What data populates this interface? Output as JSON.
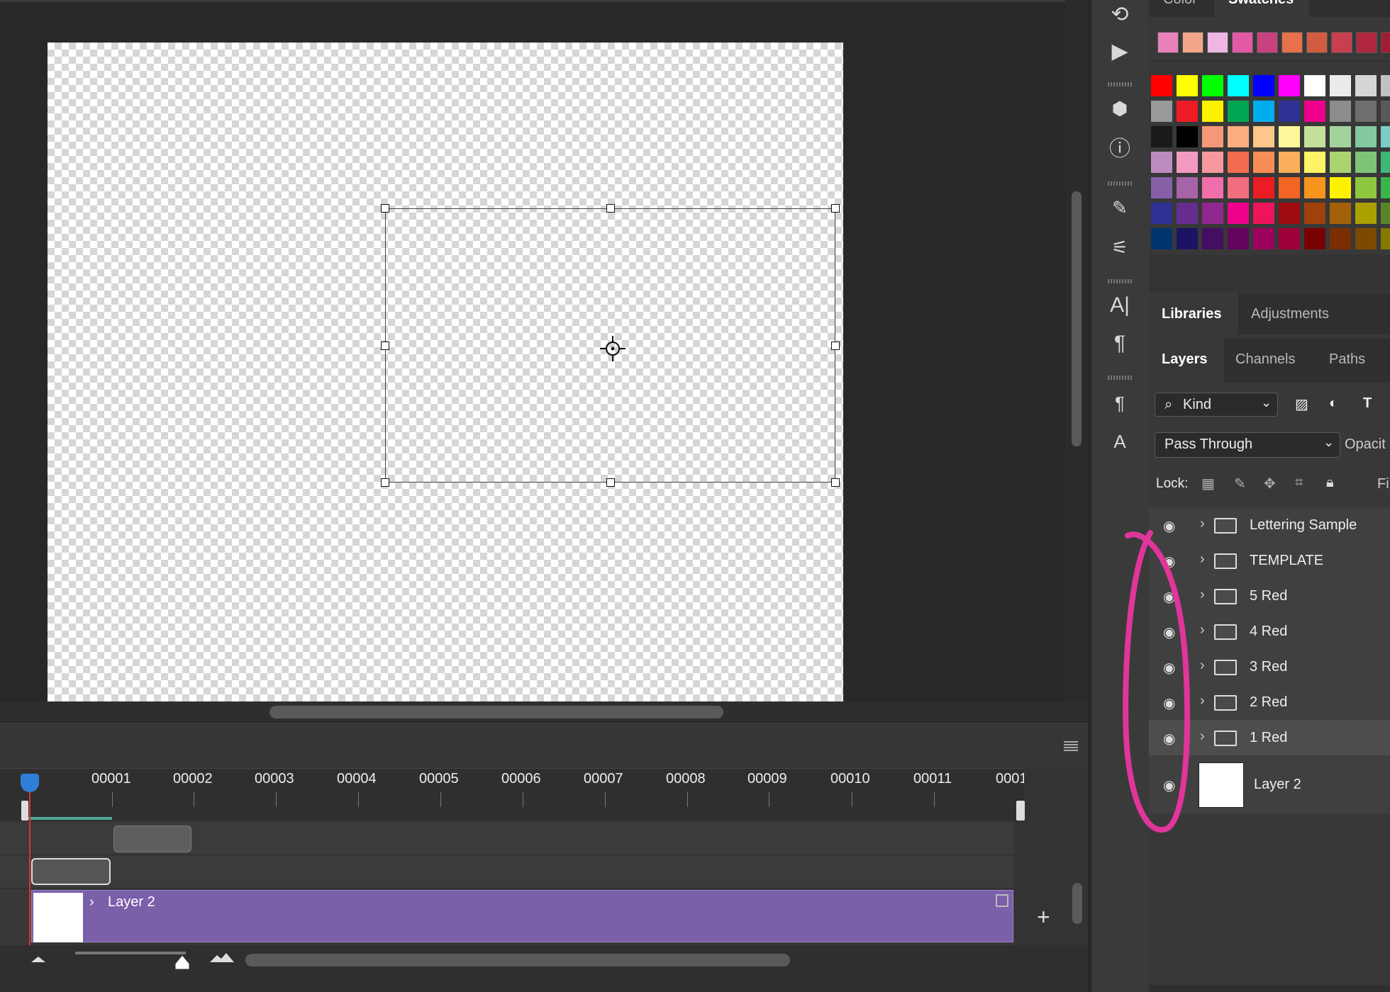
{
  "swatches_panel": {
    "tab_color": "Color",
    "tab_swatches": "Swatches",
    "recent": [
      "#e882b8",
      "#f4a68a",
      "#eeb6e2",
      "#e25aa6",
      "#c94280",
      "#e7704d",
      "#d25c42",
      "#c8404f",
      "#b0283e",
      "#a01e34",
      "#c23c5c"
    ],
    "grid": [
      [
        "#ff0000",
        "#ffff00",
        "#00ff00",
        "#00ffff",
        "#0000ff",
        "#ff00ff",
        "#ffffff",
        "#ebebeb",
        "#d6d6d6",
        "#c2c2c2"
      ],
      [
        "#999999",
        "#ed1c24",
        "#fff200",
        "#00a651",
        "#00aeef",
        "#2e3192",
        "#ec008c",
        "#8c8c8c",
        "#6e6e6e",
        "#5a5a5a"
      ],
      [
        "#1a1a1a",
        "#000000",
        "#f7977a",
        "#f9ad81",
        "#fdc68a",
        "#fff79a",
        "#c4df9b",
        "#a3d39c",
        "#82ca9d",
        "#7bcdc8"
      ],
      [
        "#bd8cbf",
        "#f49ac2",
        "#f6989d",
        "#f26c4f",
        "#f68e55",
        "#fbaf5c",
        "#fff467",
        "#acd372",
        "#7cc576",
        "#3bb878"
      ],
      [
        "#8560a8",
        "#a763a8",
        "#f06ea9",
        "#f26d7d",
        "#ed1c24",
        "#f26522",
        "#f7941d",
        "#fff200",
        "#8dc73f",
        "#39b54a"
      ],
      [
        "#2e3192",
        "#662d91",
        "#92278f",
        "#ec008c",
        "#ed145b",
        "#9e0b0f",
        "#a0410d",
        "#a36209",
        "#aba000",
        "#598527"
      ],
      [
        "#003471",
        "#1b1464",
        "#440e62",
        "#630460",
        "#9e005d",
        "#9e0039",
        "#790000",
        "#7b2e00",
        "#7d4900",
        "#827b00"
      ]
    ]
  },
  "panels": {
    "libraries": "Libraries",
    "adjustments": "Adjustments",
    "layers": "Layers",
    "channels": "Channels",
    "paths": "Paths"
  },
  "layers_controls": {
    "filter_kind": "Kind",
    "blend_mode": "Pass Through",
    "opacity_label": "Opacit",
    "lock_label": "Lock:",
    "fill_label": "Fi"
  },
  "layers": [
    {
      "name": "Lettering Sample",
      "type": "group"
    },
    {
      "name": "TEMPLATE",
      "type": "group"
    },
    {
      "name": "5 Red",
      "type": "group"
    },
    {
      "name": "4 Red",
      "type": "group"
    },
    {
      "name": "3 Red",
      "type": "group"
    },
    {
      "name": "2 Red",
      "type": "group"
    },
    {
      "name": "1 Red",
      "type": "group"
    },
    {
      "name": "Layer 2",
      "type": "layer"
    }
  ],
  "timeline": {
    "ticks": [
      "00001",
      "00002",
      "00003",
      "00004",
      "00005",
      "00006",
      "00007",
      "00008",
      "00009",
      "00010",
      "00011",
      "0001"
    ],
    "clip_label": "Layer 2",
    "add_label": "+"
  },
  "colors": {
    "clip_purple": "#7a5fa9",
    "annotation_pink": "#e0359a",
    "playhead_blue": "#2f7fd8"
  }
}
